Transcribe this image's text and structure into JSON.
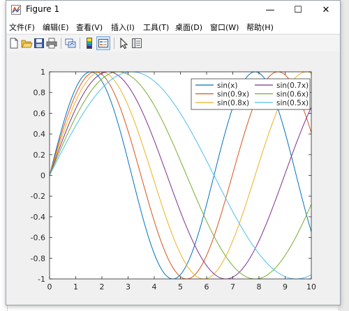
{
  "window": {
    "title": "Figure 1"
  },
  "title_buttons": {
    "minimize": "—",
    "maximize": "☐",
    "close": "✕"
  },
  "menu": [
    {
      "label": "文件(F)"
    },
    {
      "label": "编辑(E)"
    },
    {
      "label": "查看(V)"
    },
    {
      "label": "插入(I)"
    },
    {
      "label": "工具(T)"
    },
    {
      "label": "桌面(D)"
    },
    {
      "label": "窗口(W)"
    },
    {
      "label": "帮助(H)"
    }
  ],
  "toolbar": [
    {
      "icon": "new-figure-icon"
    },
    {
      "icon": "open-file-icon"
    },
    {
      "icon": "save-icon"
    },
    {
      "icon": "print-icon"
    },
    {
      "icon": "link-plot-icon"
    },
    {
      "icon": "insert-colorbar-icon"
    },
    {
      "icon": "insert-legend-icon"
    },
    {
      "icon": "edit-plot-arrow-icon"
    },
    {
      "icon": "property-inspector-icon"
    }
  ],
  "chart_data": {
    "type": "line",
    "function": "y = sin(k*x)",
    "x_range": [
      0,
      10
    ],
    "xlim": [
      0,
      10
    ],
    "ylim": [
      -1,
      1
    ],
    "xticks": [
      "0",
      "1",
      "2",
      "3",
      "4",
      "5",
      "6",
      "7",
      "8",
      "9",
      "10"
    ],
    "yticks": [
      "1",
      "0.8",
      "0.6",
      "0.4",
      "0.2",
      "0",
      "-0.2",
      "-0.4",
      "-0.6",
      "-0.8",
      "-1"
    ],
    "grid": false,
    "legend_location": "top-right",
    "legend_columns": 2,
    "series": [
      {
        "name": "sin(x)",
        "k": 1.0,
        "color": "#0072BD"
      },
      {
        "name": "sin(0.9x)",
        "k": 0.9,
        "color": "#D95319"
      },
      {
        "name": "sin(0.8x)",
        "k": 0.8,
        "color": "#EDB120"
      },
      {
        "name": "sin(0.7x)",
        "k": 0.7,
        "color": "#7E2F8E"
      },
      {
        "name": "sin(0.6x)",
        "k": 0.6,
        "color": "#77AC30"
      },
      {
        "name": "sin(0.5x)",
        "k": 0.5,
        "color": "#4DBEEE"
      }
    ]
  }
}
